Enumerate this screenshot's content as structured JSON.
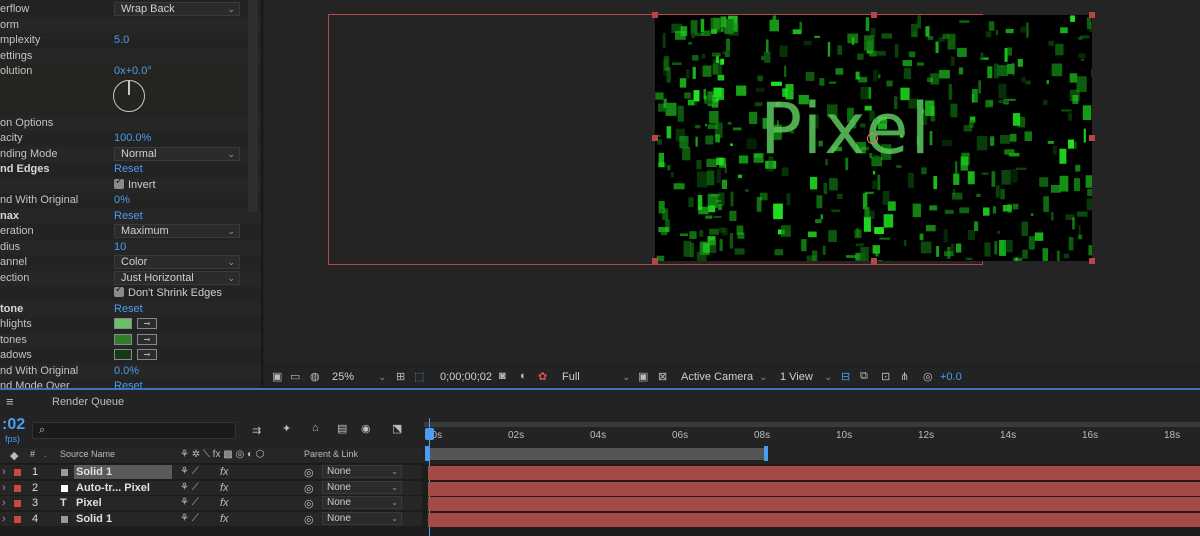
{
  "effects": {
    "rows": [
      {
        "label": "erflow",
        "kind": "select",
        "value": "Wrap Back"
      },
      {
        "label": "orm",
        "kind": "none"
      },
      {
        "label": "mplexity",
        "kind": "value",
        "value": "5.0"
      },
      {
        "label": "ettings",
        "kind": "none"
      },
      {
        "label": "olution",
        "kind": "value",
        "value": "0x+0.0°"
      },
      {
        "label": "on Options",
        "kind": "none"
      },
      {
        "label": "acity",
        "kind": "value",
        "value": "100.0%"
      },
      {
        "label": "nding Mode",
        "kind": "select",
        "value": "Normal"
      },
      {
        "label": "nd Edges",
        "kind": "link",
        "value": "Reset",
        "bold": true
      },
      {
        "label": "",
        "kind": "check",
        "value": "Invert"
      },
      {
        "label": "nd With Original",
        "kind": "value",
        "value": "0%"
      },
      {
        "label": "nax",
        "kind": "link",
        "value": "Reset",
        "bold": true
      },
      {
        "label": "eration",
        "kind": "select",
        "value": "Maximum"
      },
      {
        "label": "dius",
        "kind": "value",
        "value": "10"
      },
      {
        "label": "annel",
        "kind": "select",
        "value": "Color"
      },
      {
        "label": "ection",
        "kind": "select",
        "value": "Just Horizontal"
      },
      {
        "label": "",
        "kind": "check",
        "value": "Don't Shrink Edges"
      },
      {
        "label": "tone",
        "kind": "link",
        "value": "Reset",
        "bold": true
      },
      {
        "label": "hlights",
        "kind": "swatch",
        "color": "#6abf6a"
      },
      {
        "label": "tones",
        "kind": "swatch",
        "color": "#2f7d2f"
      },
      {
        "label": "adows",
        "kind": "swatch",
        "color": "#153a15"
      },
      {
        "label": "nd With Original",
        "kind": "value",
        "value": "0.0%"
      },
      {
        "label": "nd Mode Over",
        "kind": "link",
        "value": "Reset"
      }
    ]
  },
  "viewer": {
    "pixel_text": "Pixel",
    "zoom": "25%",
    "timecode": "0;00;00;02",
    "resolution": "Full",
    "camera": "Active Camera",
    "views": "1 View",
    "exposure": "+0.0"
  },
  "timeline": {
    "panel_tab": "Render Queue",
    "current_time": ":02",
    "fps": "fps)",
    "search_placeholder": "",
    "columns": {
      "num": "#",
      "source_name": "Source Name",
      "parent": "Parent & Link"
    },
    "ruler_ticks": [
      "00s",
      "02s",
      "04s",
      "06s",
      "08s",
      "10s",
      "12s",
      "14s",
      "16s",
      "18s"
    ],
    "layers": [
      {
        "num": "1",
        "name": "Solid 1",
        "color": "#c84a44",
        "type_color": "#9a9a9a",
        "parent": "None",
        "selected": true
      },
      {
        "num": "2",
        "name": "Auto-tr... Pixel",
        "color": "#c84a44",
        "type_color": "#ffffff",
        "parent": "None"
      },
      {
        "num": "3",
        "name": "Pixel",
        "color": "#c84a44",
        "type_color": "T",
        "parent": "None"
      },
      {
        "num": "4",
        "name": "Solid 1",
        "color": "#c84a44",
        "type_color": "#9a9a9a",
        "parent": "None"
      }
    ],
    "switch_fx": "fx",
    "accent": "#4a9df0"
  }
}
